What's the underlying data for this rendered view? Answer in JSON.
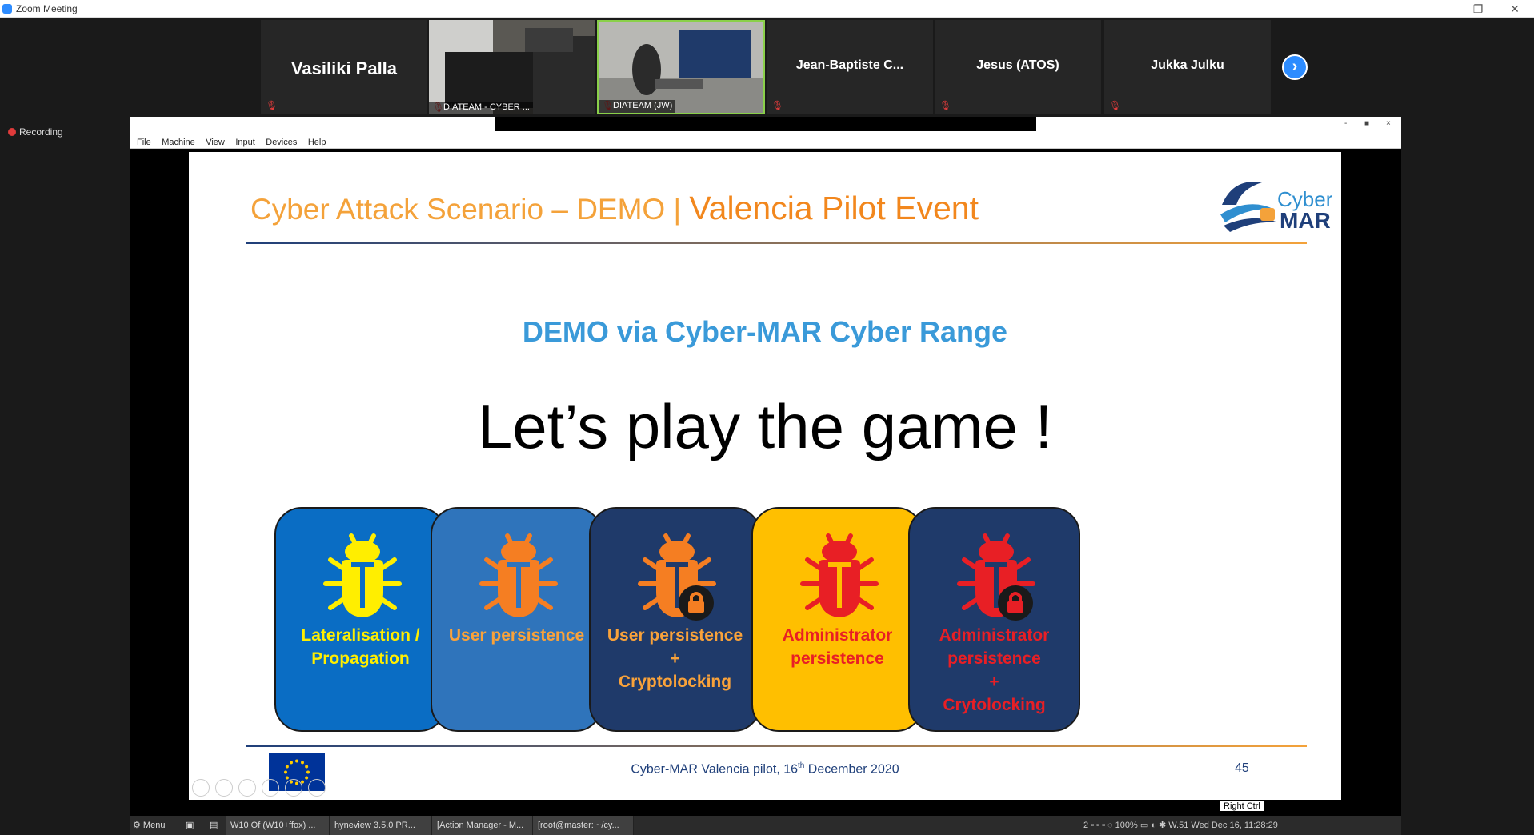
{
  "window": {
    "title": "Zoom Meeting",
    "minimize": "—",
    "restore": "❐",
    "close": "✕"
  },
  "participants": [
    {
      "name": "Vasiliki Palla"
    },
    {
      "name": "DIATEAM - CYBER ...",
      "video": true
    },
    {
      "name": "DIATEAM (JW)",
      "video": true
    },
    {
      "name": "Jean-Baptiste  C..."
    },
    {
      "name": "Jesus (ATOS)"
    },
    {
      "name": "Jukka Julku"
    }
  ],
  "next_label": "›",
  "recording_label": "Recording",
  "vm": {
    "menu": [
      "File",
      "Machine",
      "View",
      "Input",
      "Devices",
      "Help"
    ],
    "controls": [
      "-",
      "■",
      "×"
    ],
    "status_right": "Right Ctrl"
  },
  "slide": {
    "title_part1": "Cyber Attack Scenario – DEMO",
    "title_sep": " | ",
    "title_part2": "Valencia Pilot Event",
    "logo_line1": "Cyber",
    "logo_line2": "MAR",
    "subtitle": "DEMO via Cyber-MAR Cyber Range",
    "headline": "Let’s play the game !",
    "cards": [
      {
        "line1": "Lateralisation /",
        "line2": "Propagation",
        "bg": "#0a6dc4",
        "bug": "#ffee00",
        "text": "#ffee00",
        "lock": false
      },
      {
        "line1": "User persistence",
        "line2": "",
        "bg": "#2f74bb",
        "bug": "#f57e22",
        "text": "#f9a23a",
        "lock": false
      },
      {
        "line1": "User persistence",
        "line2": "+",
        "line3": "Cryptolocking",
        "bg": "#1f3a6a",
        "bug": "#f57e22",
        "text": "#f9a23a",
        "lock": true
      },
      {
        "line1": "Administrator",
        "line2": "persistence",
        "bg": "#ffbf00",
        "bug": "#e81f25",
        "text": "#e81f25",
        "lock": false
      },
      {
        "line1": "Administrator",
        "line2": "persistence",
        "line3": "+",
        "line4": "Crytolocking",
        "bg": "#1f3a6a",
        "bug": "#e81f25",
        "text": "#e81f25",
        "lock": true
      }
    ],
    "footer_pre": "Cyber-MAR Valencia pilot, 16",
    "footer_sup": "th",
    "footer_post": " December 2020",
    "page_number": "45"
  },
  "taskbar": {
    "menu": "Menu",
    "items": [
      "W10 Of (W10+ffox) ...",
      "hyneview 3.5.0 PR...",
      "[Action Manager - M...",
      "[root@master: ~/cy..."
    ],
    "tray_text": "2",
    "zoom_pct": "100%",
    "clock": "W.51 Wed Dec 16, 11:28:29"
  }
}
